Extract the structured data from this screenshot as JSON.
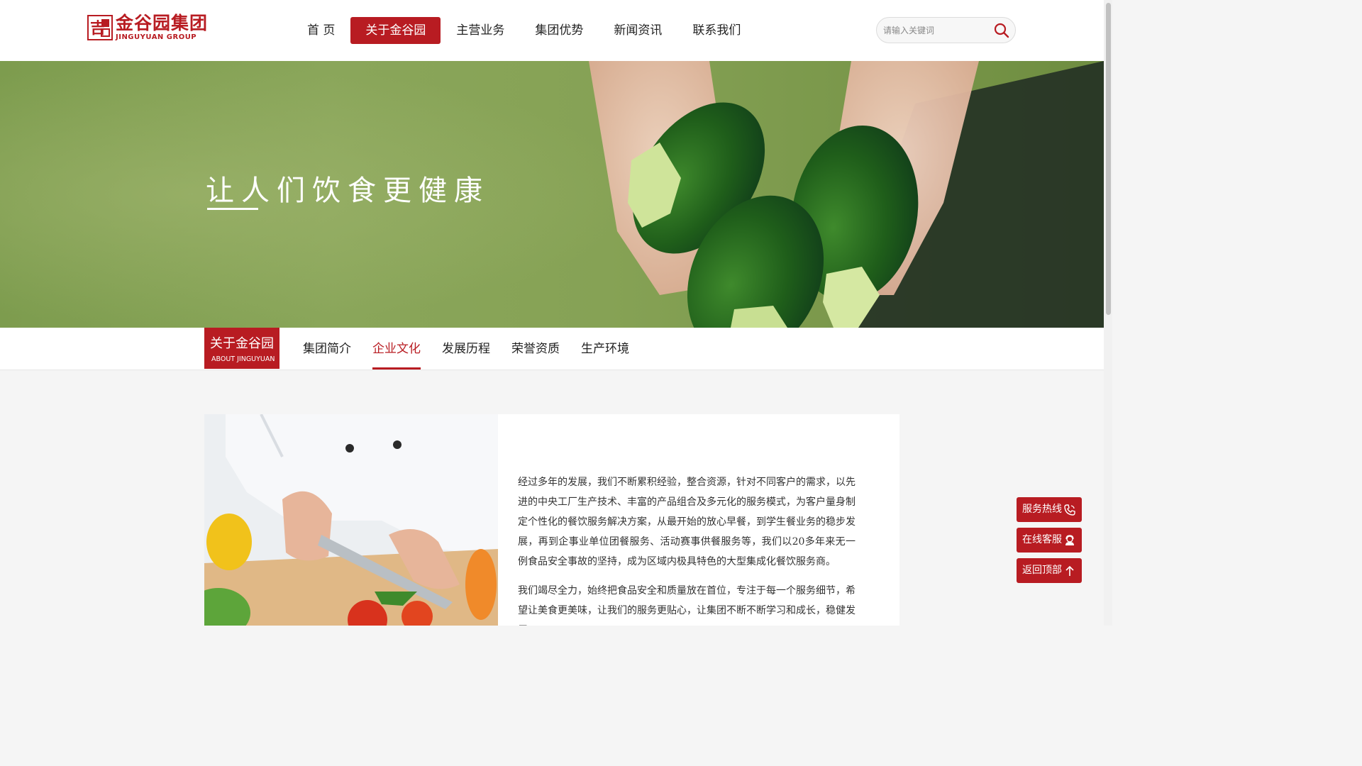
{
  "header": {
    "logo_cn": "金谷园集团",
    "logo_en": "JINGUYUAN GROUP",
    "logo_seal": "吉",
    "nav": [
      {
        "label": "首 页",
        "active": false
      },
      {
        "label": "关于金谷园",
        "active": true
      },
      {
        "label": "主营业务",
        "active": false
      },
      {
        "label": "集团优势",
        "active": false
      },
      {
        "label": "新闻资讯",
        "active": false
      },
      {
        "label": "联系我们",
        "active": false
      }
    ],
    "search": {
      "placeholder": "请输入关键词",
      "value": ""
    }
  },
  "banner": {
    "title": "让人们饮食更健康"
  },
  "subnav": {
    "badge_cn": "关于金谷园",
    "badge_en": "ABOUT JINGUYUAN",
    "items": [
      {
        "label": "集团简介",
        "active": false
      },
      {
        "label": "企业文化",
        "active": true
      },
      {
        "label": "发展历程",
        "active": false
      },
      {
        "label": "荣誉资质",
        "active": false
      },
      {
        "label": "生产环境",
        "active": false
      }
    ]
  },
  "content": {
    "paragraphs": [
      "经过多年的发展，我们不断累积经验，整合资源，针对不同客户的需求，以先进的中央工厂生产技术、丰富的产品组合及多元化的服务模式，为客户量身制定个性化的餐饮服务解决方案，从最开始的放心早餐，到学生餐业务的稳步发展，再到企事业单位团餐服务、活动赛事供餐服务等，我们以20多年来无一例食品安全事故的坚持，成为区域内极具特色的大型集成化餐饮服务商。",
      "我们竭尽全力，始终把食品安全和质量放在首位，专注于每一个服务细节，希望让美食更美味，让我们的服务更贴心，让集团不断不断学习和成长，稳健发展。"
    ]
  },
  "float_buttons": [
    {
      "label": "服务热线",
      "icon": "phone-icon"
    },
    {
      "label": "在线客服",
      "icon": "customer-service-icon"
    },
    {
      "label": "返回顶部",
      "icon": "arrow-up-icon"
    }
  ],
  "colors": {
    "brand_red": "#b81c22"
  }
}
